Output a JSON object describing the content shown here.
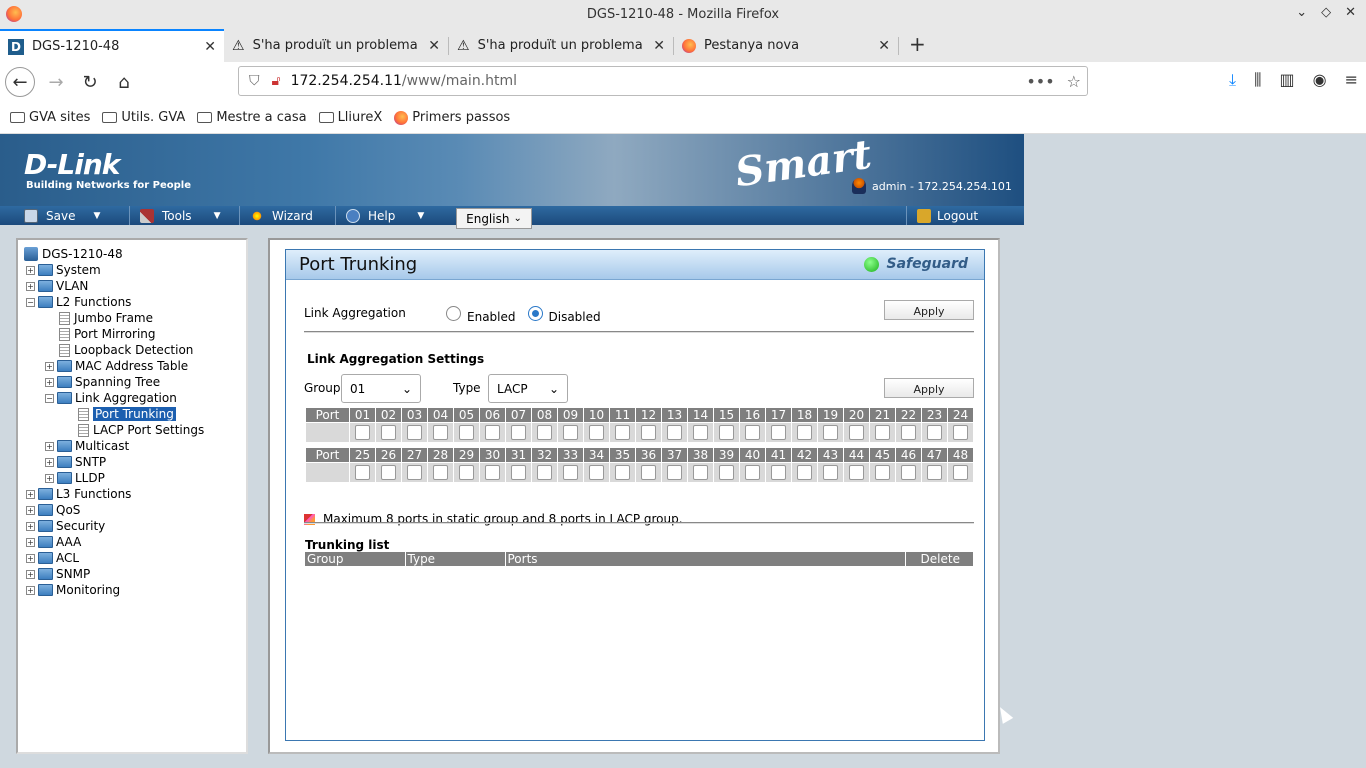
{
  "window": {
    "title": "DGS-1210-48 - Mozilla Firefox",
    "controls": [
      "⌄",
      "◇",
      "✕"
    ]
  },
  "tabs": [
    {
      "title": "DGS-1210-48",
      "icon": "dlink-favicon",
      "active": true
    },
    {
      "title": "S'ha produït un problema",
      "icon": "warning-icon"
    },
    {
      "title": "S'ha produït un problema",
      "icon": "warning-icon"
    },
    {
      "title": "Pestanya nova",
      "icon": "firefox-icon"
    }
  ],
  "urlbar": {
    "host": "172.254.254.11",
    "path": "/www/main.html",
    "more": "•••"
  },
  "bookmarks": [
    "GVA sites",
    "Utils. GVA",
    "Mestre a casa",
    "LliureX",
    "Primers passos"
  ],
  "banner": {
    "logo": "D-Link",
    "tagline": "Building Networks for People",
    "smart": "Smart",
    "admin": "admin - 172.254.254.101"
  },
  "menu": {
    "save": "Save",
    "tools": "Tools",
    "wizard": "Wizard",
    "help": "Help",
    "language": "English",
    "logout": "Logout"
  },
  "tree": [
    {
      "label": "DGS-1210-48",
      "level": 0,
      "kind": "root"
    },
    {
      "label": "System",
      "level": 0,
      "kind": "folder",
      "exp": "+"
    },
    {
      "label": "VLAN",
      "level": 0,
      "kind": "folder",
      "exp": "+"
    },
    {
      "label": "L2 Functions",
      "level": 0,
      "kind": "folder",
      "exp": "−"
    },
    {
      "label": "Jumbo Frame",
      "level": 1,
      "kind": "doc"
    },
    {
      "label": "Port Mirroring",
      "level": 1,
      "kind": "doc"
    },
    {
      "label": "Loopback Detection",
      "level": 1,
      "kind": "doc"
    },
    {
      "label": "MAC Address Table",
      "level": 1,
      "kind": "folder",
      "exp": "+"
    },
    {
      "label": "Spanning Tree",
      "level": 1,
      "kind": "folder",
      "exp": "+"
    },
    {
      "label": "Link Aggregation",
      "level": 1,
      "kind": "folder",
      "exp": "−"
    },
    {
      "label": "Port Trunking",
      "level": 2,
      "kind": "doc",
      "selected": true
    },
    {
      "label": "LACP Port Settings",
      "level": 2,
      "kind": "doc"
    },
    {
      "label": "Multicast",
      "level": 1,
      "kind": "folder",
      "exp": "+"
    },
    {
      "label": "SNTP",
      "level": 1,
      "kind": "folder",
      "exp": "+"
    },
    {
      "label": "LLDP",
      "level": 1,
      "kind": "folder",
      "exp": "+"
    },
    {
      "label": "L3 Functions",
      "level": 0,
      "kind": "folder",
      "exp": "+"
    },
    {
      "label": "QoS",
      "level": 0,
      "kind": "folder",
      "exp": "+"
    },
    {
      "label": "Security",
      "level": 0,
      "kind": "folder",
      "exp": "+"
    },
    {
      "label": "AAA",
      "level": 0,
      "kind": "folder",
      "exp": "+"
    },
    {
      "label": "ACL",
      "level": 0,
      "kind": "folder",
      "exp": "+"
    },
    {
      "label": "SNMP",
      "level": 0,
      "kind": "folder",
      "exp": "+"
    },
    {
      "label": "Monitoring",
      "level": 0,
      "kind": "folder",
      "exp": "+"
    }
  ],
  "panel": {
    "title": "Port Trunking",
    "safeguard": "Safeguard",
    "link_aggregation_label": "Link Aggregation",
    "enabled_label": "Enabled",
    "disabled_label": "Disabled",
    "link_aggregation_state": "Disabled",
    "apply_label": "Apply",
    "settings_title": "Link Aggregation Settings",
    "group_label": "Group",
    "group_value": "01",
    "type_label": "Type",
    "type_value": "LACP",
    "port_header": "Port",
    "ports_row1": [
      "01",
      "02",
      "03",
      "04",
      "05",
      "06",
      "07",
      "08",
      "09",
      "10",
      "11",
      "12",
      "13",
      "14",
      "15",
      "16",
      "17",
      "18",
      "19",
      "20",
      "21",
      "22",
      "23",
      "24"
    ],
    "ports_row2": [
      "25",
      "26",
      "27",
      "28",
      "29",
      "30",
      "31",
      "32",
      "33",
      "34",
      "35",
      "36",
      "37",
      "38",
      "39",
      "40",
      "41",
      "42",
      "43",
      "44",
      "45",
      "46",
      "47",
      "48"
    ],
    "note": "Maximum 8 ports in static group and 8 ports in LACP group.",
    "trunking_list_title": "Trunking list",
    "trunking_columns": [
      "Group",
      "Type",
      "Ports",
      "Delete"
    ]
  }
}
